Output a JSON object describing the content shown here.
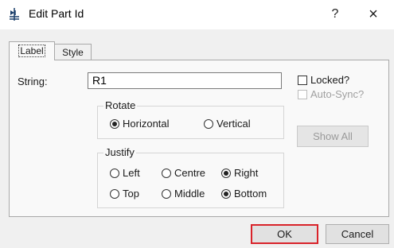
{
  "window": {
    "title": "Edit Part Id",
    "help": "?",
    "close": "×"
  },
  "tabs": [
    {
      "label": "Label"
    },
    {
      "label": "Style"
    }
  ],
  "string": {
    "label": "String:",
    "value": "R1"
  },
  "rotate": {
    "title": "Rotate",
    "options": [
      {
        "label": "Horizontal",
        "checked": true
      },
      {
        "label": "Vertical",
        "checked": false
      }
    ]
  },
  "justify": {
    "title": "Justify",
    "options": [
      {
        "label": "Left",
        "checked": false
      },
      {
        "label": "Centre",
        "checked": false
      },
      {
        "label": "Right",
        "checked": true
      },
      {
        "label": "Top",
        "checked": false
      },
      {
        "label": "Middle",
        "checked": false
      },
      {
        "label": "Bottom",
        "checked": true
      }
    ]
  },
  "locked": {
    "label": "Locked?",
    "checked": false
  },
  "autosync": {
    "label": "Auto-Sync?",
    "checked": false,
    "disabled": true
  },
  "buttons": {
    "show_all": "Show All",
    "ok": "OK",
    "cancel": "Cancel"
  }
}
